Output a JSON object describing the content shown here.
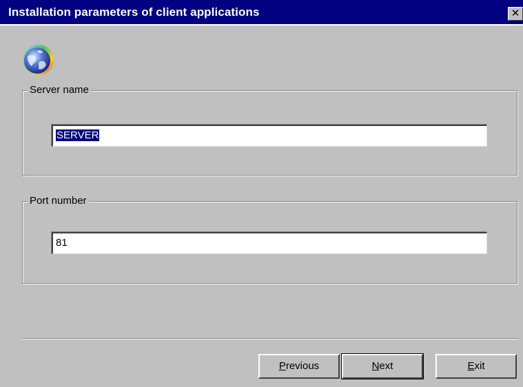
{
  "window": {
    "title": "Installation parameters of client applications",
    "close_label": "✕"
  },
  "icons": {
    "logo": "globe-icon",
    "close": "close-icon"
  },
  "server_group": {
    "legend": "Server name",
    "input_value": "SERVER",
    "input_selected": true
  },
  "port_group": {
    "legend": "Port number",
    "input_value": "81"
  },
  "buttons": {
    "previous": {
      "mnemonic": "P",
      "rest": "revious"
    },
    "next": {
      "mnemonic": "N",
      "rest": "ext"
    },
    "exit": {
      "mnemonic": "E",
      "rest": "xit"
    }
  },
  "colors": {
    "titlebar": "#000080",
    "dialog_bg": "#c0c0c0",
    "selection": "#000080"
  }
}
